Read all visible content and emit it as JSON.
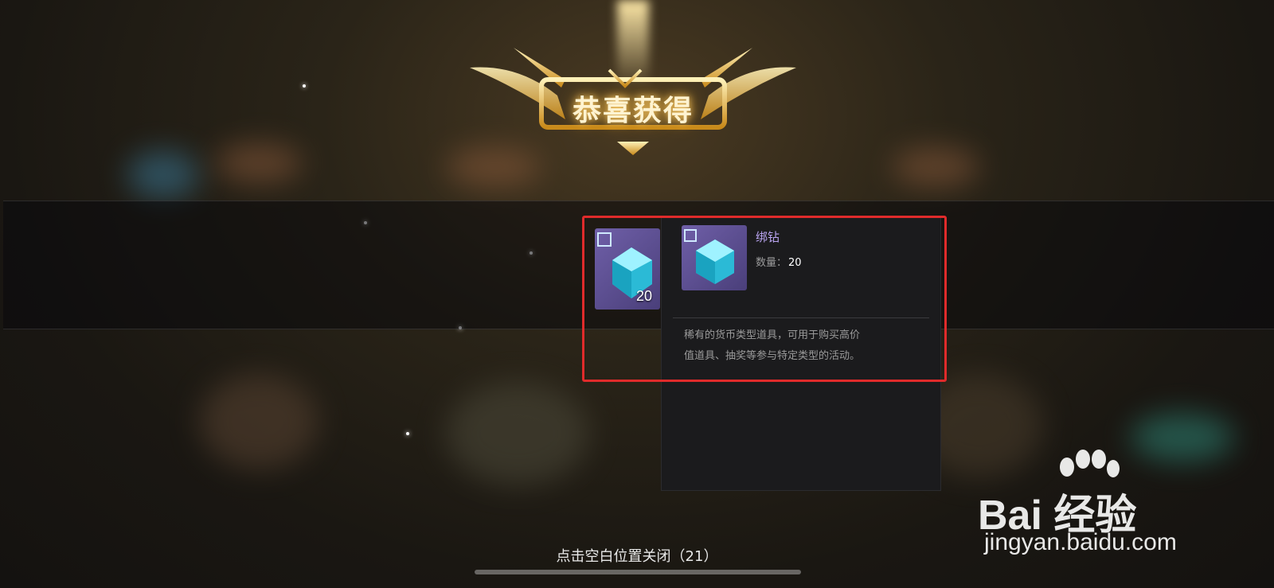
{
  "banner": {
    "title": "恭喜获得"
  },
  "reward": {
    "count": "20",
    "icon": "diamond-cube-icon"
  },
  "tooltip": {
    "name": "绑钻",
    "quantity_label": "数量：",
    "quantity_value": "20",
    "description_line1": "稀有的货币类型道具，可用于购买高价",
    "description_line2": "值道具、抽奖等参与特定类型的活动。"
  },
  "footer": {
    "close_hint": "点击空白位置关闭（21）"
  },
  "watermark": {
    "brand": "Bai 经验",
    "url": "jingyan.baidu.com"
  },
  "colors": {
    "highlight": "#e02b2b",
    "item_name": "#b9a4f0",
    "banner_glow": "#ffcf6a"
  }
}
